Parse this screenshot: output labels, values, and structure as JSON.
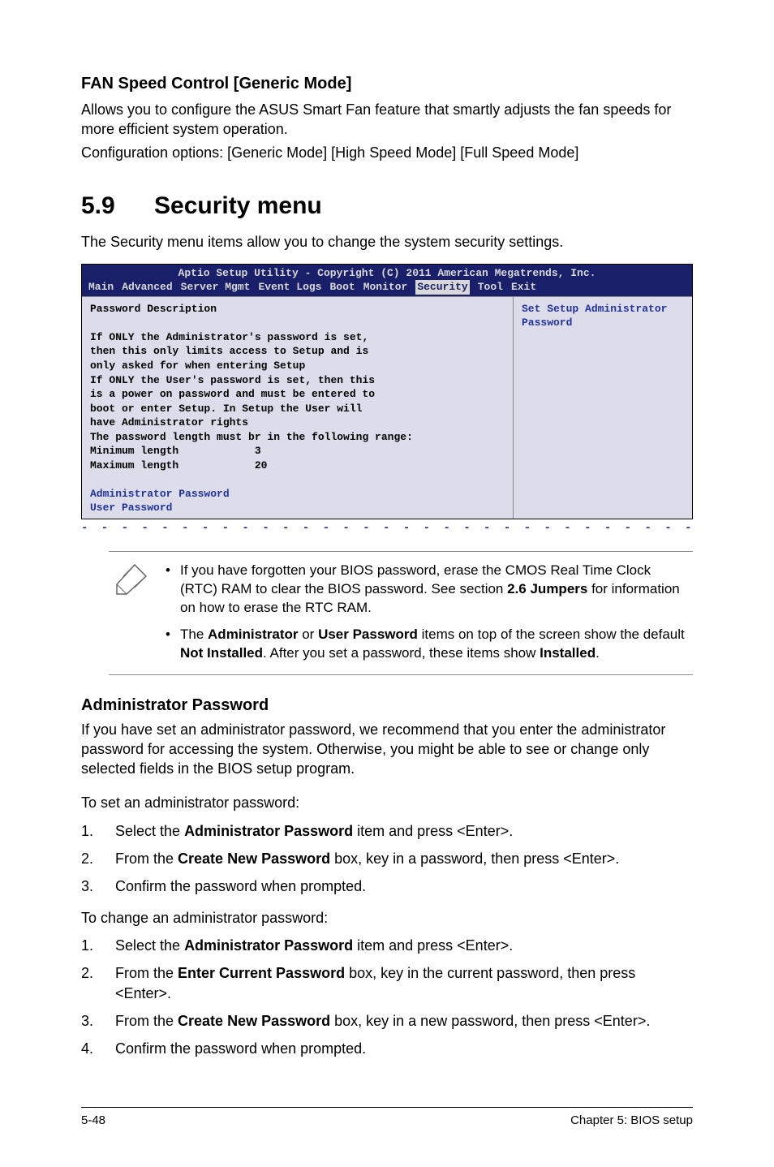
{
  "fan": {
    "heading": "FAN Speed Control [Generic Mode]",
    "desc1": "Allows you to configure the ASUS Smart Fan feature that smartly adjusts the fan speeds for more efficient system operation.",
    "desc2": "Configuration options: [Generic Mode] [High Speed Mode] [Full Speed Mode]"
  },
  "menu": {
    "number": "5.9",
    "title": "Security menu",
    "intro": "The Security menu items allow you to change the system security settings."
  },
  "bios": {
    "title": "Aptio Setup Utility - Copyright (C) 2011 American Megatrends, Inc.",
    "tabs": {
      "main": "Main",
      "advanced": "Advanced",
      "server": "Server Mgmt",
      "event": "Event Logs",
      "boot": "Boot",
      "monitor": "Monitor",
      "security": "Security",
      "tool": "Tool",
      "exit": "Exit"
    },
    "left": "Password Description\n\nIf ONLY the Administrator's password is set,\nthen this only limits access to Setup and is\nonly asked for when entering Setup\nIf ONLY the User's password is set, then this\nis a power on password and must be entered to\nboot or enter Setup. In Setup the User will\nhave Administrator rights\nThe password length must br in the following range:\nMinimum length            3\nMaximum length            20\n",
    "left_link1": "Administrator Password",
    "left_link2": "User Password",
    "right": "Set Setup Administrator\nPassword"
  },
  "note": {
    "item1_a": "If you have forgotten your BIOS password, erase the CMOS Real Time Clock (RTC) RAM to clear the BIOS password. See section ",
    "item1_b": "2.6 Jumpers",
    "item1_c": " for information on how to erase the RTC RAM.",
    "item2_a": "The ",
    "item2_b": "Administrator",
    "item2_c": " or ",
    "item2_d": "User Password",
    "item2_e": " items on top of the screen show the default ",
    "item2_f": "Not Installed",
    "item2_g": ". After you set a password, these items show ",
    "item2_h": "Installed",
    "item2_i": "."
  },
  "admin": {
    "heading": "Administrator Password",
    "para": "If you have set an administrator password, we recommend that you enter the administrator password for accessing the system. Otherwise, you might be able to see or change only selected fields in the BIOS setup program.",
    "set_intro": "To set an administrator password:",
    "set_steps": {
      "s1_a": "Select the ",
      "s1_b": "Administrator Password",
      "s1_c": " item and press <Enter>.",
      "s2_a": "From the ",
      "s2_b": "Create New Password",
      "s2_c": " box, key in a password, then press <Enter>.",
      "s3": "Confirm the password when prompted."
    },
    "change_intro": "To change an administrator password:",
    "change_steps": {
      "s1_a": "Select the ",
      "s1_b": "Administrator Password",
      "s1_c": " item and press <Enter>.",
      "s2_a": "From the ",
      "s2_b": "Enter Current Password",
      "s2_c": " box, key in the current password, then press <Enter>.",
      "s3_a": "From the ",
      "s3_b": "Create New Password",
      "s3_c": " box, key in a new password, then press <Enter>.",
      "s4": "Confirm the password when prompted."
    }
  },
  "footer": {
    "left": "5-48",
    "right": "Chapter 5: BIOS setup"
  }
}
